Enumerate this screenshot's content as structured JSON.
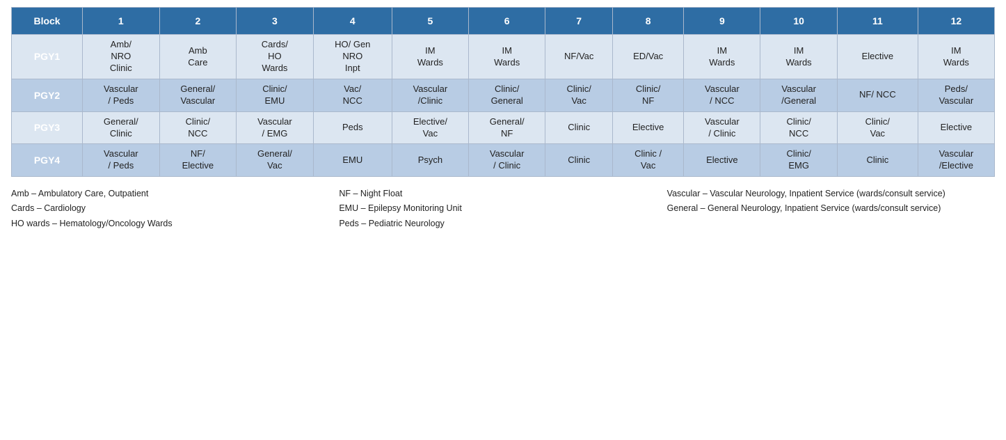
{
  "table": {
    "headers": [
      "Block",
      "1",
      "2",
      "3",
      "4",
      "5",
      "6",
      "7",
      "8",
      "9",
      "10",
      "11",
      "12"
    ],
    "rows": [
      {
        "label": "PGY1",
        "cells": [
          "Amb/\nNRO\nClinic",
          "Amb\nCare",
          "Cards/\nHO\nWards",
          "HO/ Gen\nNRO\nInpt",
          "IM\nWards",
          "IM\nWards",
          "NF/Vac",
          "ED/Vac",
          "IM\nWards",
          "IM\nWards",
          "Elective",
          "IM\nWards"
        ]
      },
      {
        "label": "PGY2",
        "cells": [
          "Vascular\n/ Peds",
          "General/\nVascular",
          "Clinic/\nEMU",
          "Vac/\nNCC",
          "Vascular\n/Clinic",
          "Clinic/\nGeneral",
          "Clinic/\nVac",
          "Clinic/\nNF",
          "Vascular\n/ NCC",
          "Vascular\n/General",
          "NF/ NCC",
          "Peds/\nVascular"
        ]
      },
      {
        "label": "PGY3",
        "cells": [
          "General/\nClinic",
          "Clinic/\nNCC",
          "Vascular\n/ EMG",
          "Peds",
          "Elective/\nVac",
          "General/\nNF",
          "Clinic",
          "Elective",
          "Vascular\n/ Clinic",
          "Clinic/\nNCC",
          "Clinic/\nVac",
          "Elective"
        ]
      },
      {
        "label": "PGY4",
        "cells": [
          "Vascular\n/ Peds",
          "NF/\nElective",
          "General/\nVac",
          "EMU",
          "Psych",
          "Vascular\n/ Clinic",
          "Clinic",
          "Clinic /\nVac",
          "Elective",
          "Clinic/\nEMG",
          "Clinic",
          "Vascular\n/Elective"
        ]
      }
    ]
  },
  "legend": {
    "col1": [
      "Amb – Ambulatory Care, Outpatient",
      "Cards – Cardiology",
      "HO wards – Hematology/Oncology Wards"
    ],
    "col2": [
      "NF – Night Float",
      "EMU – Epilepsy Monitoring Unit",
      "Peds – Pediatric Neurology"
    ],
    "col3": [
      "Vascular – Vascular Neurology, Inpatient Service (wards/consult service)",
      "General – General Neurology, Inpatient Service (wards/consult service)"
    ]
  }
}
